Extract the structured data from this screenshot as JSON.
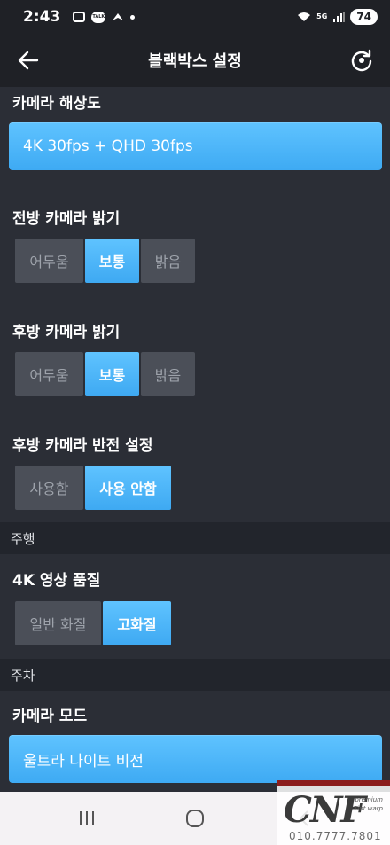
{
  "status": {
    "time": "2:43",
    "talk_label": "TALK",
    "network": "5G",
    "battery": "74"
  },
  "header": {
    "title": "블랙박스 설정",
    "back_icon": "back-arrow-icon",
    "refresh_icon": "refresh-icon"
  },
  "sections": {
    "resolution": {
      "title": "카메라 해상도",
      "value": "4K 30fps + QHD 30fps"
    },
    "front_brightness": {
      "title": "전방 카메라 밝기",
      "options": [
        "어두움",
        "보통",
        "밝음"
      ],
      "selected": "보통"
    },
    "rear_brightness": {
      "title": "후방 카메라 밝기",
      "options": [
        "어두움",
        "보통",
        "밝음"
      ],
      "selected": "보통"
    },
    "rear_flip": {
      "title": "후방 카메라 반전 설정",
      "options": [
        "사용함",
        "사용 안함"
      ],
      "selected": "사용 안함"
    },
    "driving_header": "주행",
    "quality_4k": {
      "title": "4K 영상 품질",
      "options": [
        "일반 화질",
        "고화질"
      ],
      "selected": "고화질"
    },
    "parking_header": "주차",
    "camera_mode": {
      "title": "카메라 모드",
      "value": "울트라 나이트 비전"
    }
  },
  "watermark": {
    "logo": "CNF",
    "line1": "premium",
    "line2": "Tint warp",
    "phone": "010.7777.7801"
  },
  "colors": {
    "accent": "#4ab4f8",
    "background": "#2b2e36",
    "segment_off": "#4b4f58"
  }
}
